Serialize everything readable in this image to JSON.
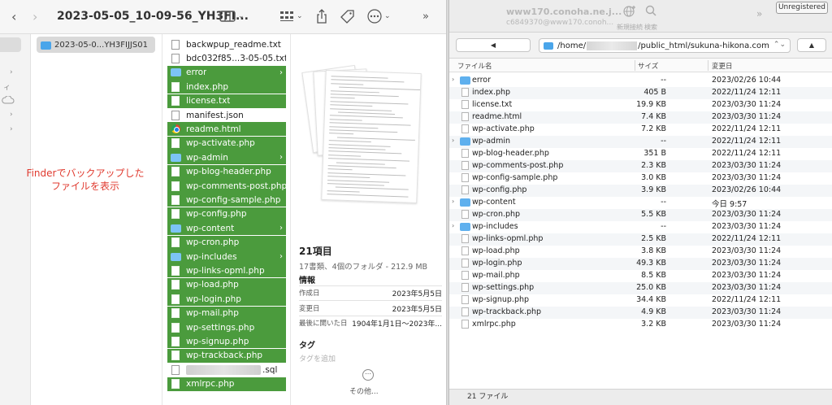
{
  "finder": {
    "title": "2023-05-05_10-09-56_YH3FI...",
    "nav_back": "‹",
    "nav_forward": "›",
    "breadcrumb_folder": "2023-05-0...YH3FIJJS01",
    "note": "Finderでバックアップした\nファイルを表示",
    "files": [
      {
        "name": "backwpup_readme.txt",
        "type": "doc",
        "selected": false
      },
      {
        "name": "bdc032f85...3-05-05.txt",
        "type": "doc",
        "selected": false
      },
      {
        "name": "error",
        "type": "folder",
        "selected": true
      },
      {
        "name": "index.php",
        "type": "doc",
        "selected": true
      },
      {
        "name": "license.txt",
        "type": "doc",
        "selected": true
      },
      {
        "name": "manifest.json",
        "type": "doc",
        "selected": false
      },
      {
        "name": "readme.html",
        "type": "chrome",
        "selected": true
      },
      {
        "name": "wp-activate.php",
        "type": "doc",
        "selected": true
      },
      {
        "name": "wp-admin",
        "type": "folder",
        "selected": true
      },
      {
        "name": "wp-blog-header.php",
        "type": "doc",
        "selected": true
      },
      {
        "name": "wp-comments-post.php",
        "type": "doc",
        "selected": true
      },
      {
        "name": "wp-config-sample.php",
        "type": "doc",
        "selected": true
      },
      {
        "name": "wp-config.php",
        "type": "doc",
        "selected": true
      },
      {
        "name": "wp-content",
        "type": "folder",
        "selected": true
      },
      {
        "name": "wp-cron.php",
        "type": "doc",
        "selected": true
      },
      {
        "name": "wp-includes",
        "type": "folder",
        "selected": true
      },
      {
        "name": "wp-links-opml.php",
        "type": "doc",
        "selected": true
      },
      {
        "name": "wp-load.php",
        "type": "doc",
        "selected": true
      },
      {
        "name": "wp-login.php",
        "type": "doc",
        "selected": true
      },
      {
        "name": "wp-mail.php",
        "type": "doc",
        "selected": true
      },
      {
        "name": "wp-settings.php",
        "type": "doc",
        "selected": true
      },
      {
        "name": "wp-signup.php",
        "type": "doc",
        "selected": true
      },
      {
        "name": "wp-trackback.php",
        "type": "doc",
        "selected": true
      },
      {
        "name": ".sql",
        "type": "blurred",
        "selected": false
      },
      {
        "name": "xmlrpc.php",
        "type": "doc",
        "selected": true
      }
    ],
    "preview": {
      "count": "21項目",
      "subtitle": "17書類、4個のフォルダ - 212.9 MB",
      "info_heading": "情報",
      "rows": [
        {
          "label": "作成日",
          "value": "2023年5月5日"
        },
        {
          "label": "変更日",
          "value": "2023年5月5日"
        },
        {
          "label": "最後に開いた日",
          "value": "1904年1月1日〜2023年..."
        }
      ],
      "tags_heading": "タグ",
      "tags_placeholder": "タグを追加",
      "more_label": "その他..."
    }
  },
  "ftp": {
    "host": "www170.conoha.ne.j...",
    "user": "c6849370@www170.conoh...",
    "new_connection": "新規接続",
    "search": "検索",
    "badge": "Unregistered",
    "path_prefix": "/home/",
    "path_suffix": "/public_html/sukuna-hikona.com",
    "columns": {
      "name": "ファイル名",
      "size": "サイズ",
      "modified": "変更日"
    },
    "rows": [
      {
        "name": "error",
        "folder": true,
        "size": "--",
        "date": "2023/02/26 10:44"
      },
      {
        "name": "index.php",
        "folder": false,
        "size": "405 B",
        "date": "2022/11/24 12:11"
      },
      {
        "name": "license.txt",
        "folder": false,
        "size": "19.9 KB",
        "date": "2023/03/30 11:24"
      },
      {
        "name": "readme.html",
        "folder": false,
        "size": "7.4 KB",
        "date": "2023/03/30 11:24"
      },
      {
        "name": "wp-activate.php",
        "folder": false,
        "size": "7.2 KB",
        "date": "2022/11/24 12:11"
      },
      {
        "name": "wp-admin",
        "folder": true,
        "size": "--",
        "date": "2022/11/24 12:11"
      },
      {
        "name": "wp-blog-header.php",
        "folder": false,
        "size": "351 B",
        "date": "2022/11/24 12:11"
      },
      {
        "name": "wp-comments-post.php",
        "folder": false,
        "size": "2.3 KB",
        "date": "2023/03/30 11:24"
      },
      {
        "name": "wp-config-sample.php",
        "folder": false,
        "size": "3.0 KB",
        "date": "2023/03/30 11:24"
      },
      {
        "name": "wp-config.php",
        "folder": false,
        "size": "3.9 KB",
        "date": "2023/02/26 10:44"
      },
      {
        "name": "wp-content",
        "folder": true,
        "size": "--",
        "date": "今日 9:57"
      },
      {
        "name": "wp-cron.php",
        "folder": false,
        "size": "5.5 KB",
        "date": "2023/03/30 11:24"
      },
      {
        "name": "wp-includes",
        "folder": true,
        "size": "--",
        "date": "2023/03/30 11:24"
      },
      {
        "name": "wp-links-opml.php",
        "folder": false,
        "size": "2.5 KB",
        "date": "2022/11/24 12:11"
      },
      {
        "name": "wp-load.php",
        "folder": false,
        "size": "3.8 KB",
        "date": "2023/03/30 11:24"
      },
      {
        "name": "wp-login.php",
        "folder": false,
        "size": "49.3 KB",
        "date": "2023/03/30 11:24"
      },
      {
        "name": "wp-mail.php",
        "folder": false,
        "size": "8.5 KB",
        "date": "2023/03/30 11:24"
      },
      {
        "name": "wp-settings.php",
        "folder": false,
        "size": "25.0 KB",
        "date": "2023/03/30 11:24"
      },
      {
        "name": "wp-signup.php",
        "folder": false,
        "size": "34.4 KB",
        "date": "2022/11/24 12:11"
      },
      {
        "name": "wp-trackback.php",
        "folder": false,
        "size": "4.9 KB",
        "date": "2023/03/30 11:24"
      },
      {
        "name": "xmlrpc.php",
        "folder": false,
        "size": "3.2 KB",
        "date": "2023/03/30 11:24"
      }
    ],
    "footer": "21 ファイル"
  },
  "colors": {
    "selection": "#4b9b3d",
    "folder": "#4aa5ea",
    "note": "#e03a2f"
  }
}
